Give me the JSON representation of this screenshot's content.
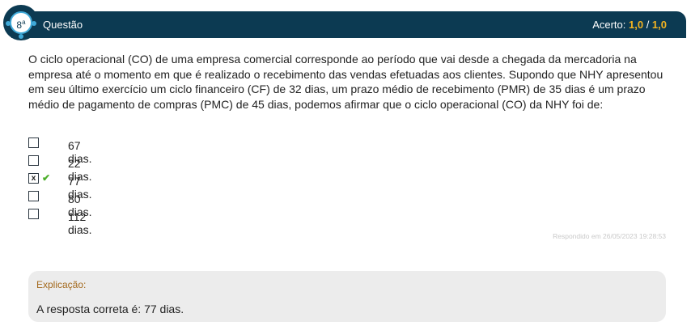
{
  "header": {
    "title": "Questão",
    "score_label": "Acerto:",
    "score_value": "1,0",
    "score_sep": " / ",
    "score_total": "1,0"
  },
  "badge": {
    "number": "8",
    "suffix": "a"
  },
  "question": {
    "text": "O ciclo operacional (CO) de uma empresa comercial corresponde ao período que vai desde a chegada da mercadoria na empresa até o momento em que é realizado o recebimento das vendas efetuadas aos clientes. Supondo que NHY apresentou em seu último exercício um ciclo financeiro (CF) de 32 dias, um prazo médio de recebimento (PMR) de 35 dias é um prazo médio de pagamento de compras (PMC) de 45 dias, podemos afirmar que o ciclo operacional (CO) da NHY foi de:"
  },
  "options": [
    {
      "label": "67 dias.",
      "mark": ""
    },
    {
      "label": "22 dias.",
      "mark": ""
    },
    {
      "label": "77 dias.",
      "mark": "x"
    },
    {
      "label": "80 dias.",
      "mark": ""
    },
    {
      "label": "112 dias.",
      "mark": ""
    }
  ],
  "answered": "Respondido em 26/05/2023 19:28:53",
  "explanation": {
    "heading": "Explicação:",
    "text": "A resposta correta é: 77 dias."
  },
  "colors": {
    "header_bg": "#0c3a52",
    "accent": "#f2b320",
    "badge_ring": "#3fa9d8",
    "check": "#4caf2a",
    "explain_heading": "#a46a1e"
  }
}
